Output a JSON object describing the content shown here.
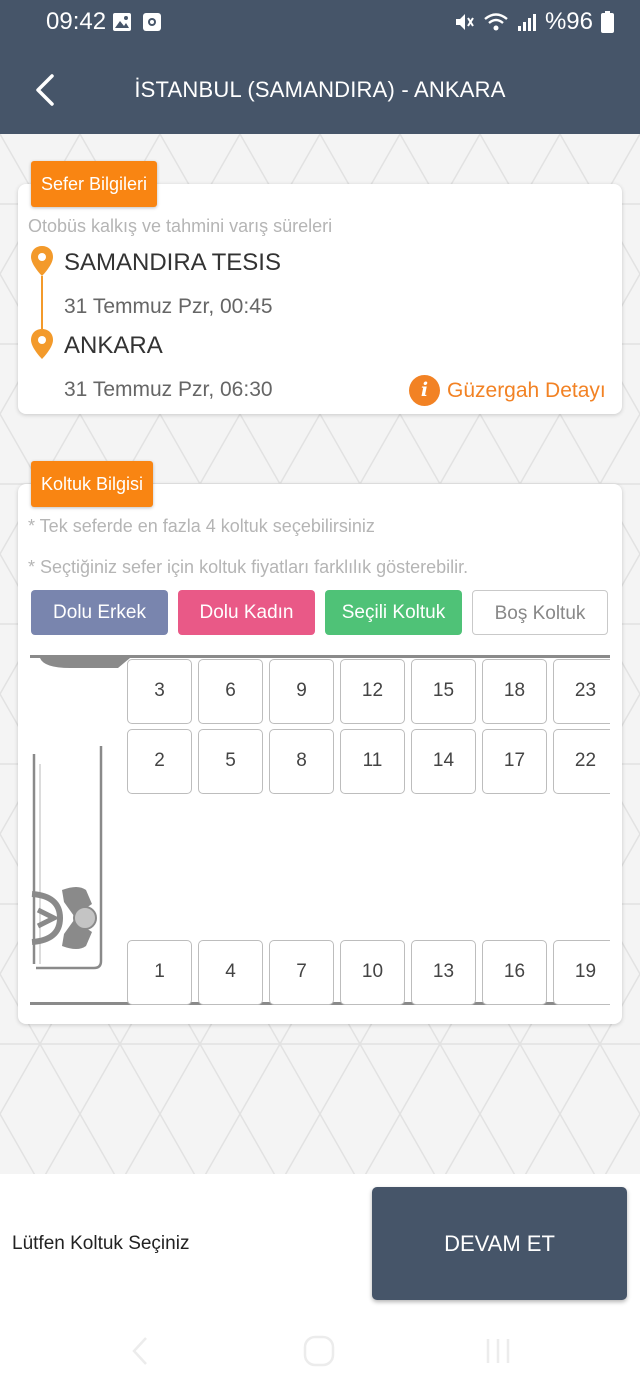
{
  "status_bar": {
    "time": "09:42",
    "battery": "%96"
  },
  "header": {
    "title": "İSTANBUL (SAMANDIRA) - ANKARA"
  },
  "trip_info": {
    "tag": "Sefer Bilgileri",
    "hint": "Otobüs kalkış ve tahmini varış süreleri",
    "departure": {
      "name": "SAMANDIRA TESIS",
      "time": "31 Temmuz Pzr, 00:45"
    },
    "arrival": {
      "name": "ANKARA",
      "time": "31 Temmuz Pzr, 06:30"
    },
    "route_detail": "Güzergah Detayı"
  },
  "seat_info": {
    "tag": "Koltuk Bilgisi",
    "note1": "* Tek seferde en fazla 4 koltuk seçebilirsiniz",
    "note2": "* Seçtiğiniz sefer için koltuk fiyatları farklılık gösterebilir.",
    "legend": {
      "occupied_male": "Dolu Erkek",
      "occupied_female": "Dolu Kadın",
      "selected": "Seçili Koltuk",
      "empty": "Boş Koltuk"
    },
    "rows": [
      [
        "3",
        "6",
        "9",
        "12",
        "15",
        "18",
        "23"
      ],
      [
        "2",
        "5",
        "8",
        "11",
        "14",
        "17",
        "22"
      ],
      [
        "1",
        "4",
        "7",
        "10",
        "13",
        "16",
        "19"
      ]
    ]
  },
  "footer": {
    "message": "Lütfen Koltuk Seçiniz",
    "continue_label": "DEVAM ET"
  },
  "colors": {
    "header": "#465569",
    "accent": "#f98512",
    "male": "#7985ae",
    "female": "#e95987",
    "selected": "#4fc277"
  }
}
